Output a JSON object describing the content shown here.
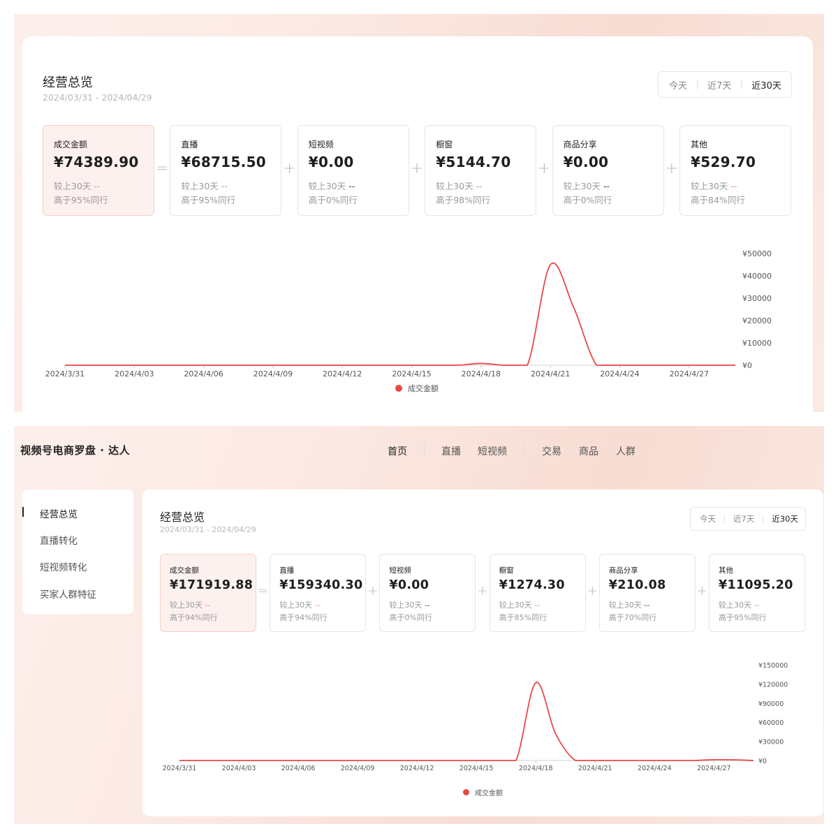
{
  "top": {
    "title": "经营总览",
    "date_range": "2024/03/31 - 2024/04/29",
    "range_tabs": [
      "今天",
      "近7天",
      "近30天"
    ],
    "active_range": "近30天",
    "operators": [
      "=",
      "+",
      "+",
      "+",
      "+"
    ],
    "metrics": [
      {
        "label": "成交金额",
        "value": "¥74389.90",
        "compare": "较上30天",
        "compare_val": "--",
        "rank": "高于95%同行"
      },
      {
        "label": "直播",
        "value": "¥68715.50",
        "compare": "较上30天",
        "compare_val": "--",
        "rank": "高于95%同行"
      },
      {
        "label": "短视频",
        "value": "¥0.00",
        "compare": "较上30天",
        "compare_val": "--",
        "rank": "高于0%同行"
      },
      {
        "label": "橱窗",
        "value": "¥5144.70",
        "compare": "较上30天",
        "compare_val": "--",
        "rank": "高于98%同行"
      },
      {
        "label": "商品分享",
        "value": "¥0.00",
        "compare": "较上30天",
        "compare_val": "--",
        "rank": "高于0%同行"
      },
      {
        "label": "其他",
        "value": "¥529.70",
        "compare": "较上30天",
        "compare_val": "--",
        "rank": "高于84%同行"
      }
    ],
    "legend": "成交金额"
  },
  "bottom": {
    "app_title": "视频号电商罗盘 · 达人",
    "nav": [
      "首页",
      "直播",
      "短视频",
      "交易",
      "商品",
      "人群"
    ],
    "active_nav": "首页",
    "side_nav": [
      "经营总览",
      "直播转化",
      "短视频转化",
      "买家人群特征"
    ],
    "active_side": "经营总览",
    "title": "经营总览",
    "date_range": "2024/03/31 - 2024/04/29",
    "range_tabs": [
      "今天",
      "近7天",
      "近30天"
    ],
    "active_range": "近30天",
    "operators": [
      "=",
      "+",
      "+",
      "+",
      "+"
    ],
    "metrics": [
      {
        "label": "成交金额",
        "value": "¥171919.88",
        "compare": "较上30天",
        "compare_val": "--",
        "rank": "高于94%同行"
      },
      {
        "label": "直播",
        "value": "¥159340.30",
        "compare": "较上30天",
        "compare_val": "--",
        "rank": "高于94%同行"
      },
      {
        "label": "短视频",
        "value": "¥0.00",
        "compare": "较上30天",
        "compare_val": "--",
        "rank": "高于0%同行"
      },
      {
        "label": "橱窗",
        "value": "¥1274.30",
        "compare": "较上30天",
        "compare_val": "--",
        "rank": "高于85%同行"
      },
      {
        "label": "商品分享",
        "value": "¥210.08",
        "compare": "较上30天",
        "compare_val": "--",
        "rank": "高于70%同行"
      },
      {
        "label": "其他",
        "value": "¥11095.20",
        "compare": "较上30天",
        "compare_val": "--",
        "rank": "高于95%同行"
      }
    ],
    "legend": "成交金额"
  },
  "colors": {
    "accent": "#e84848",
    "card_highlight": "#fdf1ef",
    "dash": "#e58b7c"
  },
  "chart_data": [
    {
      "type": "line",
      "title": "",
      "xlabel": "",
      "ylabel": "",
      "x_ticks": [
        "2024/3/31",
        "2024/4/03",
        "2024/4/06",
        "2024/4/09",
        "2024/4/12",
        "2024/4/15",
        "2024/4/18",
        "2024/4/21",
        "2024/4/24",
        "2024/4/27"
      ],
      "y_ticks": [
        "¥0",
        "¥10000",
        "¥20000",
        "¥30000",
        "¥40000",
        "¥50000"
      ],
      "ylim": [
        0,
        50000
      ],
      "series": [
        {
          "name": "成交金额",
          "x": [
            "2024/3/31",
            "2024/4/01",
            "2024/4/02",
            "2024/4/03",
            "2024/4/04",
            "2024/4/05",
            "2024/4/06",
            "2024/4/07",
            "2024/4/08",
            "2024/4/09",
            "2024/4/10",
            "2024/4/11",
            "2024/4/12",
            "2024/4/13",
            "2024/4/14",
            "2024/4/15",
            "2024/4/16",
            "2024/4/17",
            "2024/4/18",
            "2024/4/19",
            "2024/4/20",
            "2024/4/21",
            "2024/4/22",
            "2024/4/23",
            "2024/4/24",
            "2024/4/25",
            "2024/4/26",
            "2024/4/27",
            "2024/4/28",
            "2024/4/29"
          ],
          "values": [
            0,
            0,
            0,
            0,
            0,
            0,
            0,
            0,
            0,
            0,
            0,
            0,
            0,
            0,
            0,
            0,
            0,
            0,
            800,
            0,
            0,
            45000,
            26000,
            0,
            0,
            0,
            0,
            0,
            0,
            0
          ]
        }
      ],
      "legend_position": "bottom"
    },
    {
      "type": "line",
      "title": "",
      "xlabel": "",
      "ylabel": "",
      "x_ticks": [
        "2024/3/31",
        "2024/4/03",
        "2024/4/06",
        "2024/4/09",
        "2024/4/12",
        "2024/4/15",
        "2024/4/18",
        "2024/4/21",
        "2024/4/24",
        "2024/4/27"
      ],
      "y_ticks": [
        "¥0",
        "¥30000",
        "¥60000",
        "¥90000",
        "¥120000",
        "¥150000"
      ],
      "ylim": [
        0,
        150000
      ],
      "series": [
        {
          "name": "成交金额",
          "x": [
            "2024/3/31",
            "2024/4/01",
            "2024/4/02",
            "2024/4/03",
            "2024/4/04",
            "2024/4/05",
            "2024/4/06",
            "2024/4/07",
            "2024/4/08",
            "2024/4/09",
            "2024/4/10",
            "2024/4/11",
            "2024/4/12",
            "2024/4/13",
            "2024/4/14",
            "2024/4/15",
            "2024/4/16",
            "2024/4/17",
            "2024/4/18",
            "2024/4/19",
            "2024/4/20",
            "2024/4/21",
            "2024/4/22",
            "2024/4/23",
            "2024/4/24",
            "2024/4/25",
            "2024/4/26",
            "2024/4/27",
            "2024/4/28",
            "2024/4/29"
          ],
          "values": [
            0,
            0,
            0,
            0,
            0,
            0,
            0,
            0,
            0,
            0,
            0,
            0,
            0,
            0,
            0,
            0,
            0,
            0,
            122000,
            42000,
            0,
            0,
            0,
            0,
            0,
            0,
            0,
            1200,
            1000,
            0
          ]
        }
      ],
      "legend_position": "bottom"
    }
  ]
}
